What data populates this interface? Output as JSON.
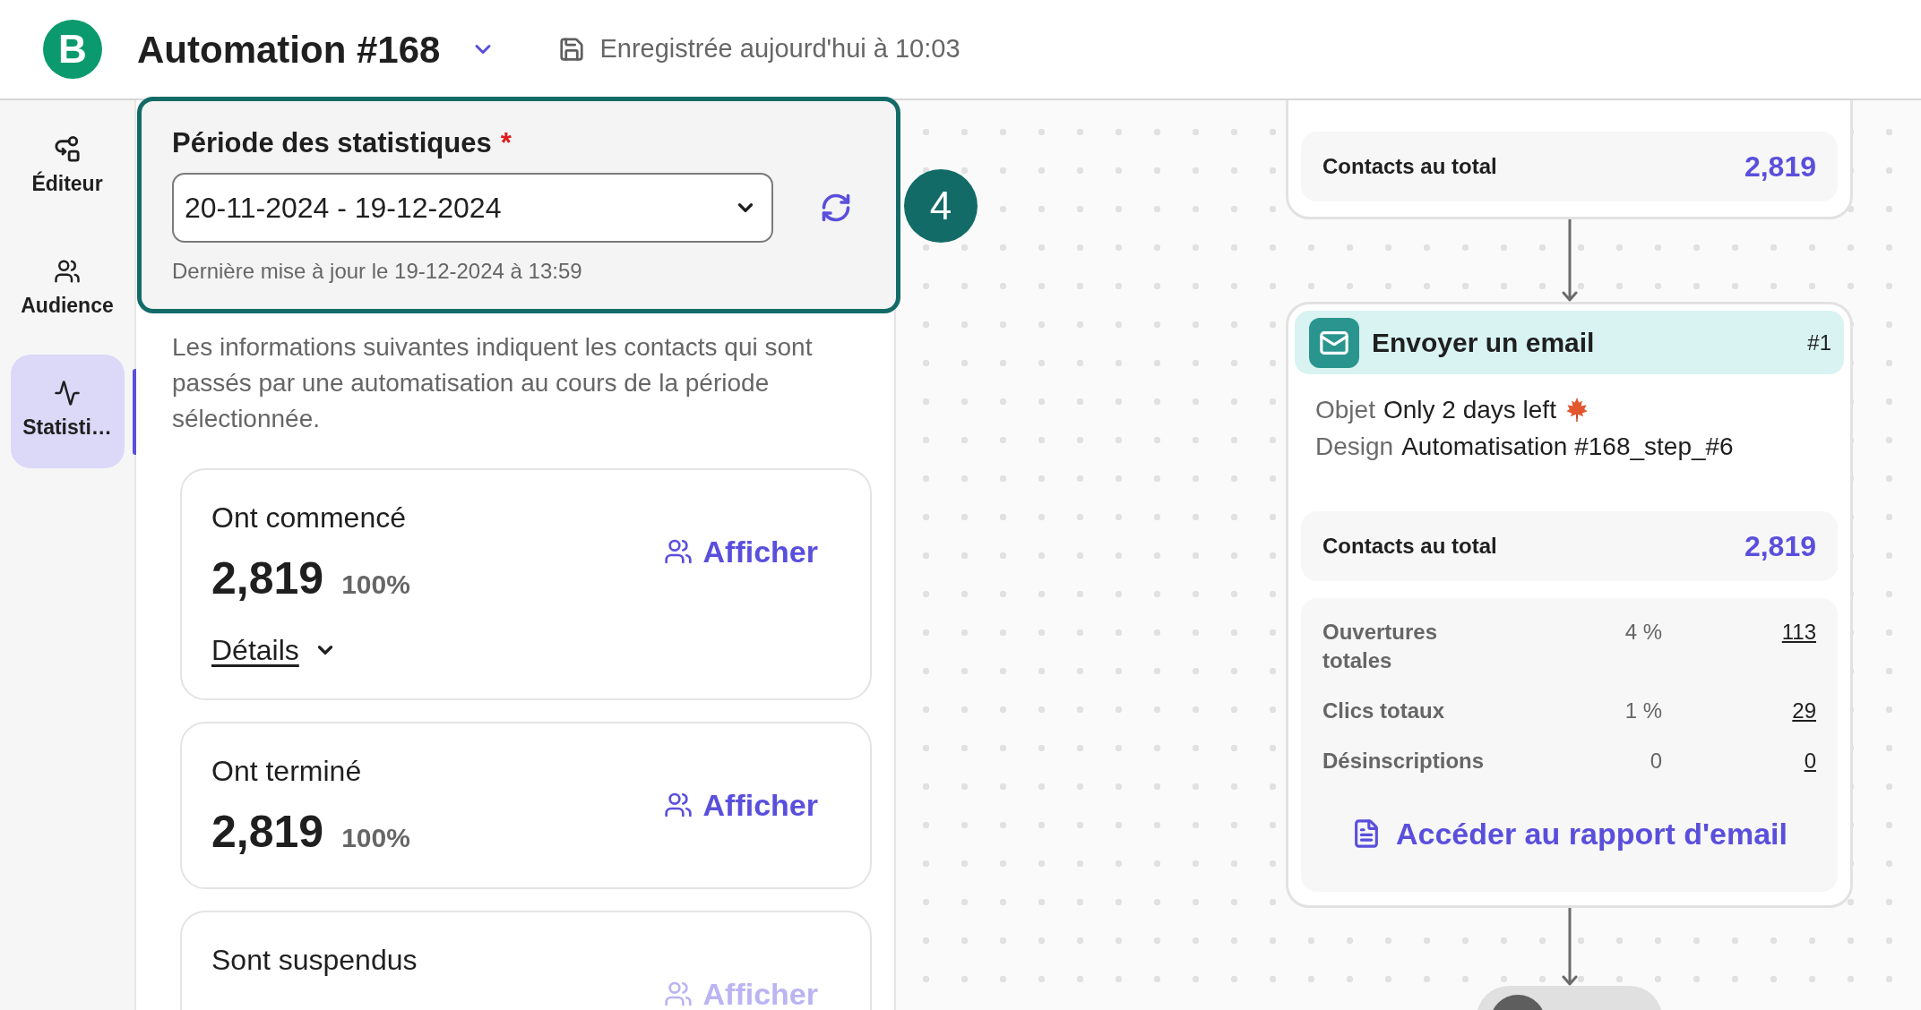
{
  "header": {
    "logo": "B",
    "title": "Automation #168",
    "saved_status": "Enregistrée aujourd'hui à 10:03"
  },
  "sidebar": {
    "items": [
      {
        "kind": "editor",
        "label": "Éditeur",
        "selected": false
      },
      {
        "kind": "audience",
        "label": "Audience",
        "selected": false
      },
      {
        "kind": "statistics",
        "label": "Statisti…",
        "selected": true
      }
    ]
  },
  "stats_panel": {
    "period": {
      "label": "Période des statistiques",
      "required_mark": "*",
      "value": "20-11-2024 - 19-12-2024",
      "last_updated": "Dernière mise à jour le 19-12-2024 à 13:59"
    },
    "tour_step": "4",
    "description": "Les informations suivantes indiquent les contacts qui sont passés par une automatisation au cours de la période sélectionnée.",
    "cards": [
      {
        "title": "Ont commencé",
        "count": "2,819",
        "percent": "100%",
        "action": "Afficher",
        "disabled": false,
        "details": "Détails"
      },
      {
        "title": "Ont terminé",
        "count": "2,819",
        "percent": "100%",
        "action": "Afficher",
        "disabled": false
      },
      {
        "title": "Sont suspendus",
        "action": "Afficher",
        "disabled": true
      }
    ]
  },
  "canvas": {
    "nodes": [
      {
        "kind": "summary",
        "total_label": "Contacts au total",
        "total": "2,819"
      },
      {
        "kind": "email",
        "title": "Envoyer un email",
        "step": "#1",
        "fields": [
          {
            "kind": "subject",
            "label": "Objet",
            "value": "Only 2 days left"
          },
          {
            "kind": "design",
            "label": "Design",
            "value": "Automatisation #168_step_#6"
          }
        ],
        "total_label": "Contacts au total",
        "total": "2,819",
        "metrics": [
          {
            "label": "Ouvertures totales",
            "rate": "4 %",
            "count": "113"
          },
          {
            "label": "Clics totaux",
            "rate": "1 %",
            "count": "29"
          },
          {
            "label": "Désinscriptions",
            "rate": "0",
            "count": "0"
          }
        ],
        "report_link": "Accéder au rapport d'email"
      },
      {
        "kind": "exit"
      }
    ]
  }
}
